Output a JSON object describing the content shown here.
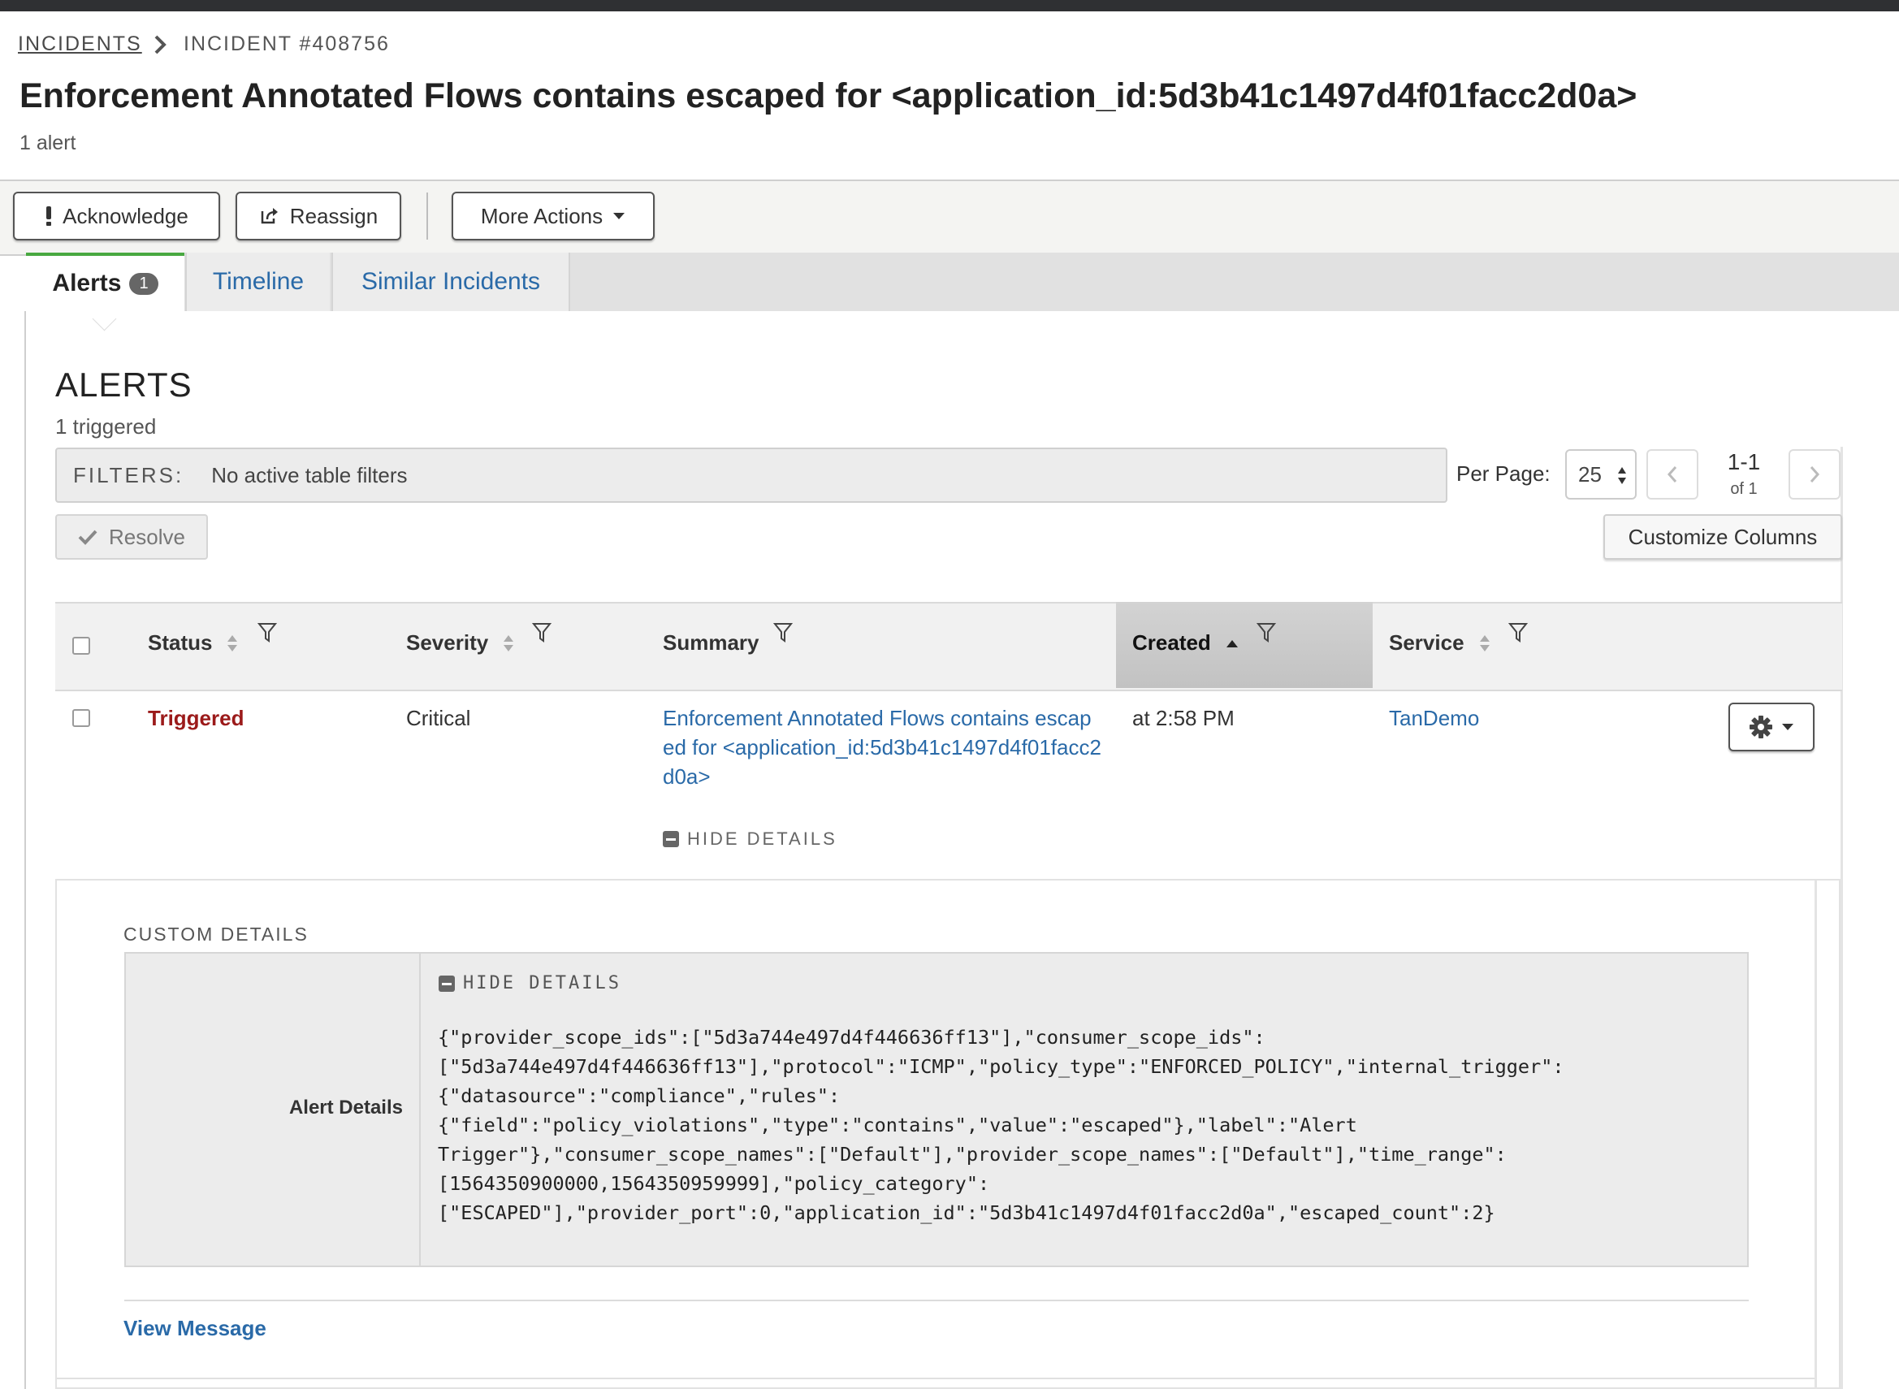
{
  "breadcrumb": {
    "parent": "INCIDENTS",
    "current": "INCIDENT #408756"
  },
  "incident": {
    "title": "Enforcement Annotated Flows contains escaped for <application_id:5d3b41c1497d4f01facc2d0a>",
    "alert_count": "1 alert"
  },
  "toolbar": {
    "acknowledge": "Acknowledge",
    "reassign": "Reassign",
    "more_actions": "More Actions"
  },
  "tabs": {
    "alerts": "Alerts",
    "alerts_badge": "1",
    "timeline": "Timeline",
    "similar": "Similar Incidents"
  },
  "alerts_section": {
    "title": "ALERTS",
    "subtitle": "1 triggered",
    "filters_label": "FILTERS:",
    "filters_value": "No active table filters",
    "per_page_label": "Per Page:",
    "per_page_value": "25",
    "page_range": "1-1",
    "page_of": "of 1",
    "resolve": "Resolve",
    "customize_columns": "Customize Columns"
  },
  "table": {
    "columns": {
      "status": "Status",
      "severity": "Severity",
      "summary": "Summary",
      "created": "Created",
      "service": "Service"
    },
    "sorted_column": "Created",
    "rows": [
      {
        "status": "Triggered",
        "severity": "Critical",
        "summary": "Enforcement Annotated Flows contains escaped for <application_id:5d3b41c1497d4f01facc2d0a>",
        "created": "at 2:58 PM",
        "service": "TanDemo",
        "hide_details": "HIDE DETAILS"
      }
    ]
  },
  "custom_details": {
    "label": "CUSTOM DETAILS",
    "key": "Alert Details",
    "hide_details": "HIDE DETAILS",
    "json": "{\"provider_scope_ids\":[\"5d3a744e497d4f446636ff13\"],\"consumer_scope_ids\":\n[\"5d3a744e497d4f446636ff13\"],\"protocol\":\"ICMP\",\"policy_type\":\"ENFORCED_POLICY\",\"internal_trigger\":\n{\"datasource\":\"compliance\",\"rules\":\n{\"field\":\"policy_violations\",\"type\":\"contains\",\"value\":\"escaped\"},\"label\":\"Alert\nTrigger\"},\"consumer_scope_names\":[\"Default\"],\"provider_scope_names\":[\"Default\"],\"time_range\":\n[1564350900000,1564350959999],\"policy_category\":\n[\"ESCAPED\"],\"provider_port\":0,\"application_id\":\"5d3b41c1497d4f01facc2d0a\",\"escaped_count\":2}",
    "view_message": "View Message"
  },
  "colors": {
    "link": "#2a6aa8",
    "triggered": "#9b1a1a",
    "active_tab_accent": "#48a840",
    "top_bar": "#2f3033"
  },
  "icons": [
    "chevron-right-icon",
    "exclamation-icon",
    "share-icon",
    "caret-down-icon",
    "sort-icon",
    "sort-up-icon",
    "filter-icon",
    "check-icon",
    "chevron-left-icon",
    "gear-icon",
    "minus-box-icon",
    "stepper-icon"
  ]
}
